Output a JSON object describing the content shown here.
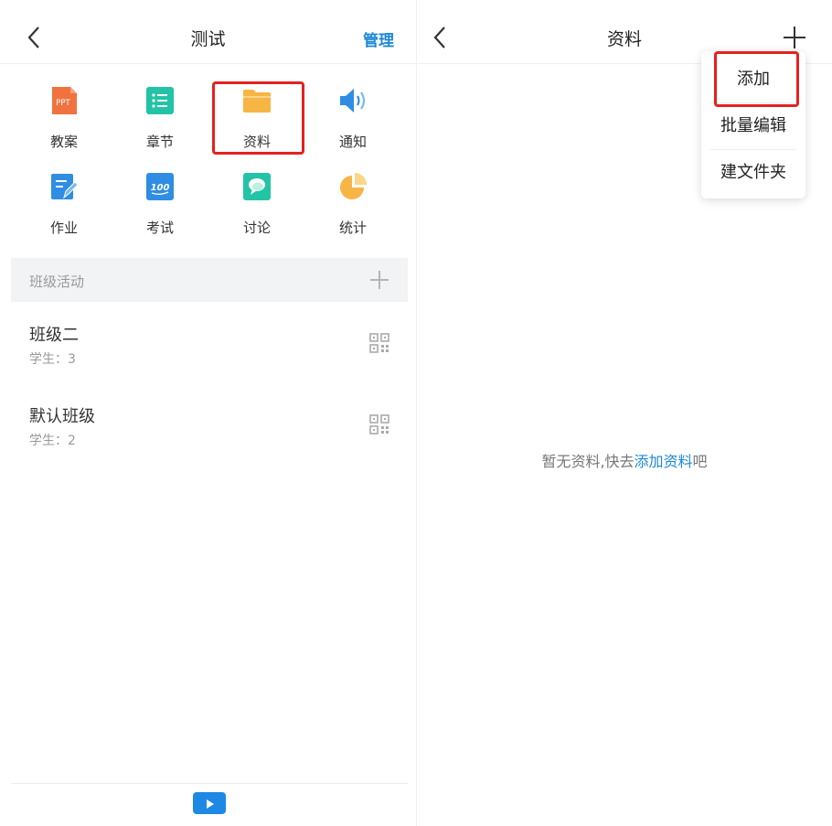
{
  "left": {
    "title": "测试",
    "manage_label": "管理",
    "tiles": [
      {
        "label": "教案",
        "icon": "ppt-icon"
      },
      {
        "label": "章节",
        "icon": "list-icon"
      },
      {
        "label": "资料",
        "icon": "folder-icon"
      },
      {
        "label": "通知",
        "icon": "speaker-icon"
      },
      {
        "label": "作业",
        "icon": "homework-edit-icon"
      },
      {
        "label": "考试",
        "icon": "score-100-icon"
      },
      {
        "label": "讨论",
        "icon": "chat-bubble-icon"
      },
      {
        "label": "统计",
        "icon": "pie-chart-icon"
      }
    ],
    "ppt_icon_text": "PPT",
    "exam_icon_text": "100",
    "section_title": "班级活动",
    "classes": [
      {
        "name": "班级二",
        "students": "学生：3"
      },
      {
        "name": "默认班级",
        "students": "学生：2"
      }
    ]
  },
  "right": {
    "title": "资料",
    "menu": [
      "添加",
      "批量编辑",
      "建文件夹"
    ],
    "empty_prefix": "暂无资料,快去",
    "empty_link": "添加资料",
    "empty_suffix": "吧"
  },
  "colors": {
    "accent": "#1e88d6",
    "highlight": "#e3221f",
    "ppt": "#f0723e",
    "list": "#22c4a5",
    "folder": "#f6b545",
    "speaker": "#2f8de4",
    "homework": "#2f8de4",
    "exam": "#2f8de4",
    "chat": "#22c4a5",
    "pie": "#f6b545"
  }
}
